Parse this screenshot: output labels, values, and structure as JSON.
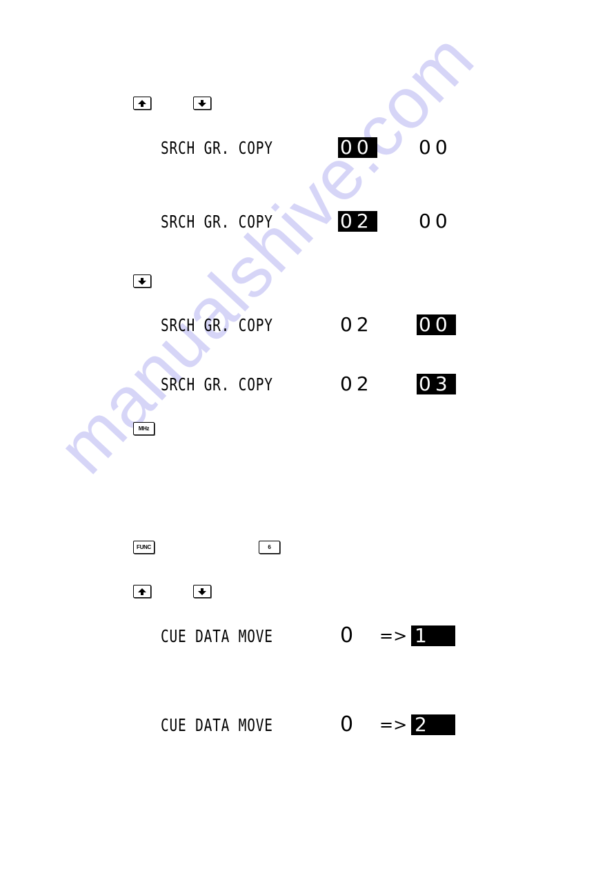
{
  "watermark": "manualshive.com",
  "keys": {
    "up": "up-arrow",
    "down": "down-arrow",
    "mhz": "MHz",
    "func": "FUNC",
    "six": "6"
  },
  "srch_copy": {
    "label": "SRCH GR. COPY",
    "steps": [
      {
        "source": "00",
        "dest": "00",
        "highlight": "source"
      },
      {
        "source": "02",
        "dest": "00",
        "highlight": "source"
      },
      {
        "source": "02",
        "dest": "00",
        "highlight": "dest"
      },
      {
        "source": "02",
        "dest": "03",
        "highlight": "dest"
      }
    ]
  },
  "cue_move": {
    "label": "CUE DATA MOVE",
    "arrow": "=>",
    "steps": [
      {
        "source": "0",
        "dest": "1"
      },
      {
        "source": "0",
        "dest": "2"
      }
    ]
  },
  "colors": {
    "text": "#000000",
    "inverse_bg": "#000000",
    "inverse_text": "#ffffff",
    "watermark": "#c9c7f5"
  }
}
